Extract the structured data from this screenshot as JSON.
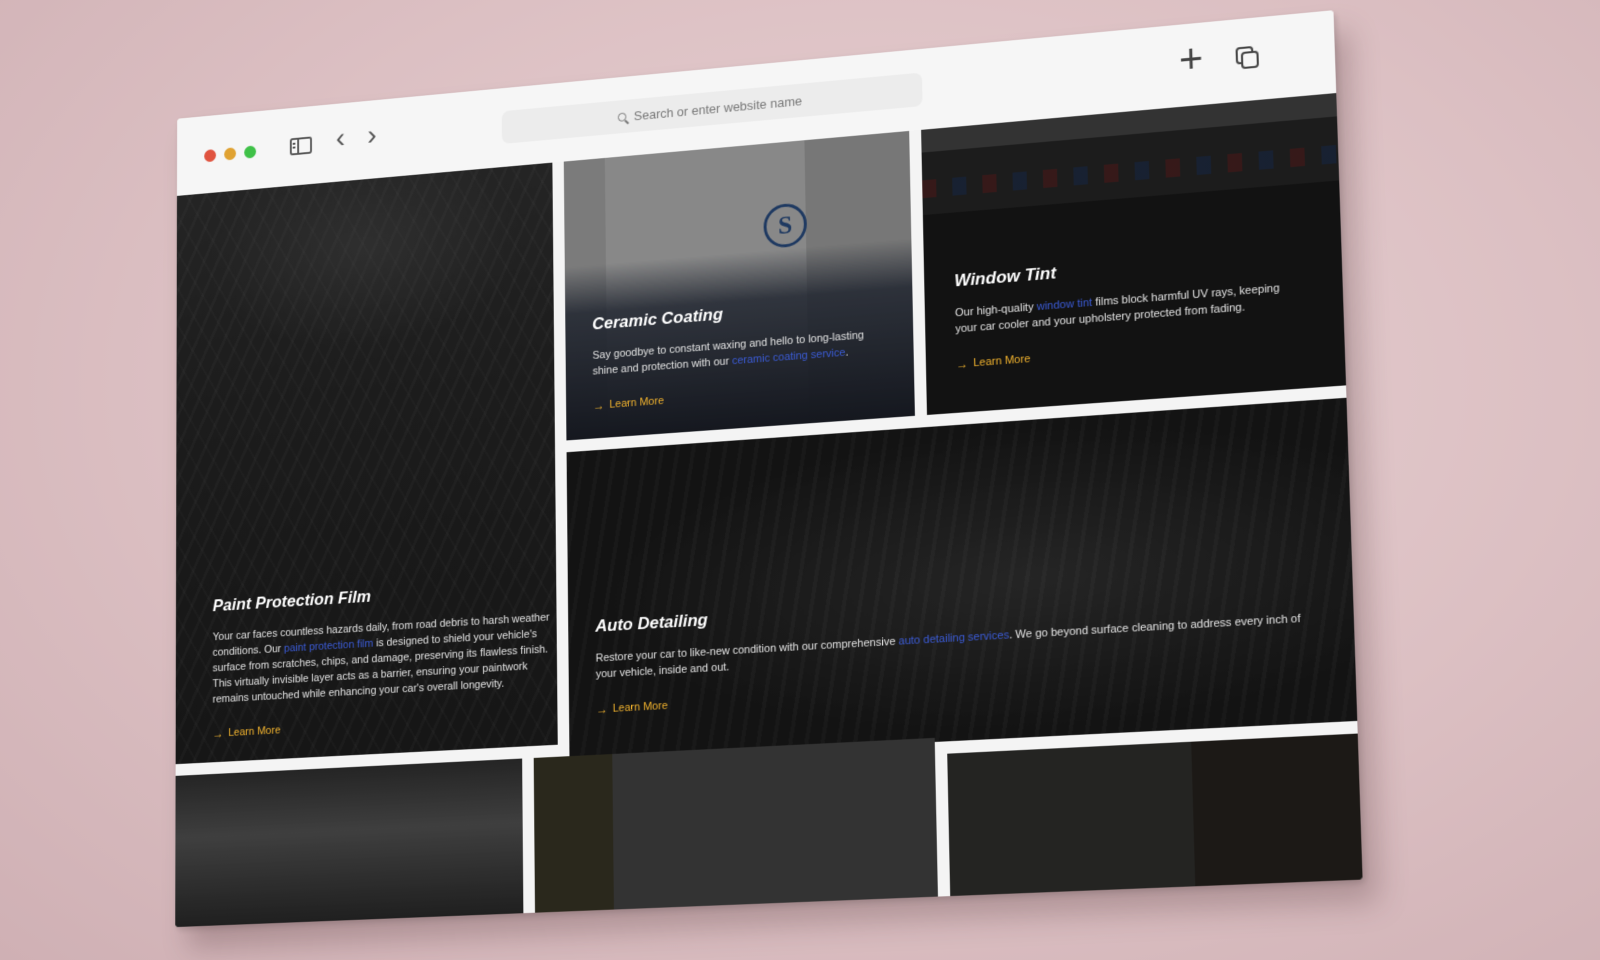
{
  "browser": {
    "address_placeholder": "Search or enter website name",
    "new_tab_icon": "plus-icon",
    "tabs_icon": "tabs-overview-icon"
  },
  "services": [
    {
      "title": "Paint Protection Film",
      "text_before": "Your car faces countless hazards daily, from road debris to harsh weather conditions. Our ",
      "link": "paint protection film",
      "text_after": " is designed to shield your vehicle's surface from scratches, chips, and damage, preserving its flawless finish. This virtually invisible layer acts as a barrier, ensuring your paintwork remains untouched while enhancing your car's overall longevity.",
      "cta": "Learn More"
    },
    {
      "title": "Ceramic Coating",
      "text_before": "Say goodbye to constant waxing and hello to long-lasting shine and protection with our ",
      "link": "ceramic coating service",
      "text_after": ".",
      "cta": "Learn More"
    },
    {
      "title": "Window Tint",
      "text_before": "Our high-quality ",
      "link": "window tint",
      "text_after": " films block harmful UV rays, keeping your car cooler and your upholstery protected from fading.",
      "cta": "Learn More"
    },
    {
      "title": "Auto Detailing",
      "text_before": "Restore your car to like-new condition with our comprehensive ",
      "link": "auto detailing services",
      "text_after": ". We go beyond surface cleaning to address every inch of your vehicle, inside and out.",
      "cta": "Learn More"
    }
  ],
  "ceramic_logo_letter": "S"
}
